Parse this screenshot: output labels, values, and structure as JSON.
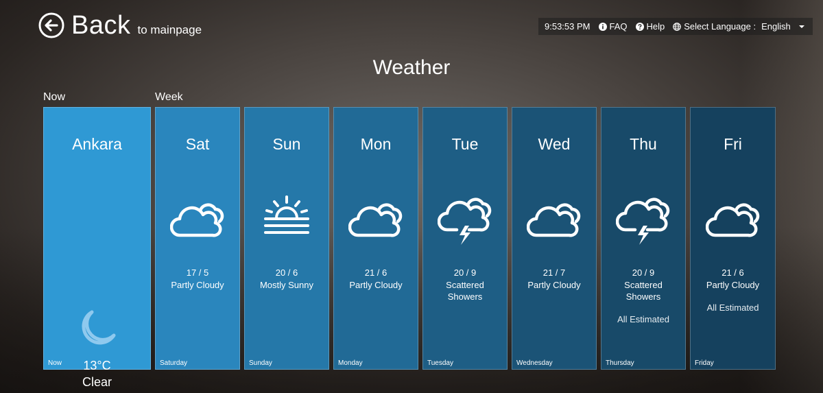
{
  "header": {
    "back_label": "Back",
    "back_sub": "to mainpage",
    "time": "9:53:53 PM",
    "faq": "FAQ",
    "help": "Help",
    "language_label": "Select Language :",
    "language_value": "English"
  },
  "page_title": "Weather",
  "labels": {
    "now": "Now",
    "week": "Week"
  },
  "now": {
    "city": "Ankara",
    "temp": "13°C",
    "condition": "Clear",
    "footer": "Now",
    "icon": "moon-icon",
    "color": "#2f99d4"
  },
  "days": [
    {
      "short": "Sat",
      "temps": "17 / 5",
      "condition": "Partly Cloudy",
      "estimate": "",
      "footer": "Saturday",
      "icon": "partly-cloudy-icon",
      "color": "#2a86bd"
    },
    {
      "short": "Sun",
      "temps": "20 / 6",
      "condition": "Mostly Sunny",
      "estimate": "",
      "footer": "Sunday",
      "icon": "mostly-sunny-icon",
      "color": "#2578a9"
    },
    {
      "short": "Mon",
      "temps": "21 / 6",
      "condition": "Partly Cloudy",
      "estimate": "",
      "footer": "Monday",
      "icon": "partly-cloudy-icon",
      "color": "#216a96"
    },
    {
      "short": "Tue",
      "temps": "20 / 9",
      "condition": "Scattered Showers",
      "estimate": "",
      "footer": "Tuesday",
      "icon": "thunder-cloud-icon",
      "color": "#1e5e85"
    },
    {
      "short": "Wed",
      "temps": "21 / 7",
      "condition": "Partly Cloudy",
      "estimate": "",
      "footer": "Wednesday",
      "icon": "partly-cloudy-icon",
      "color": "#1b5376"
    },
    {
      "short": "Thu",
      "temps": "20 / 9",
      "condition": "Scattered Showers",
      "estimate": "All Estimated",
      "footer": "Thursday",
      "icon": "thunder-cloud-icon",
      "color": "#184a69"
    },
    {
      "short": "Fri",
      "temps": "21 / 6",
      "condition": "Partly Cloudy",
      "estimate": "All Estimated",
      "footer": "Friday",
      "icon": "partly-cloudy-icon",
      "color": "#15415e"
    }
  ]
}
